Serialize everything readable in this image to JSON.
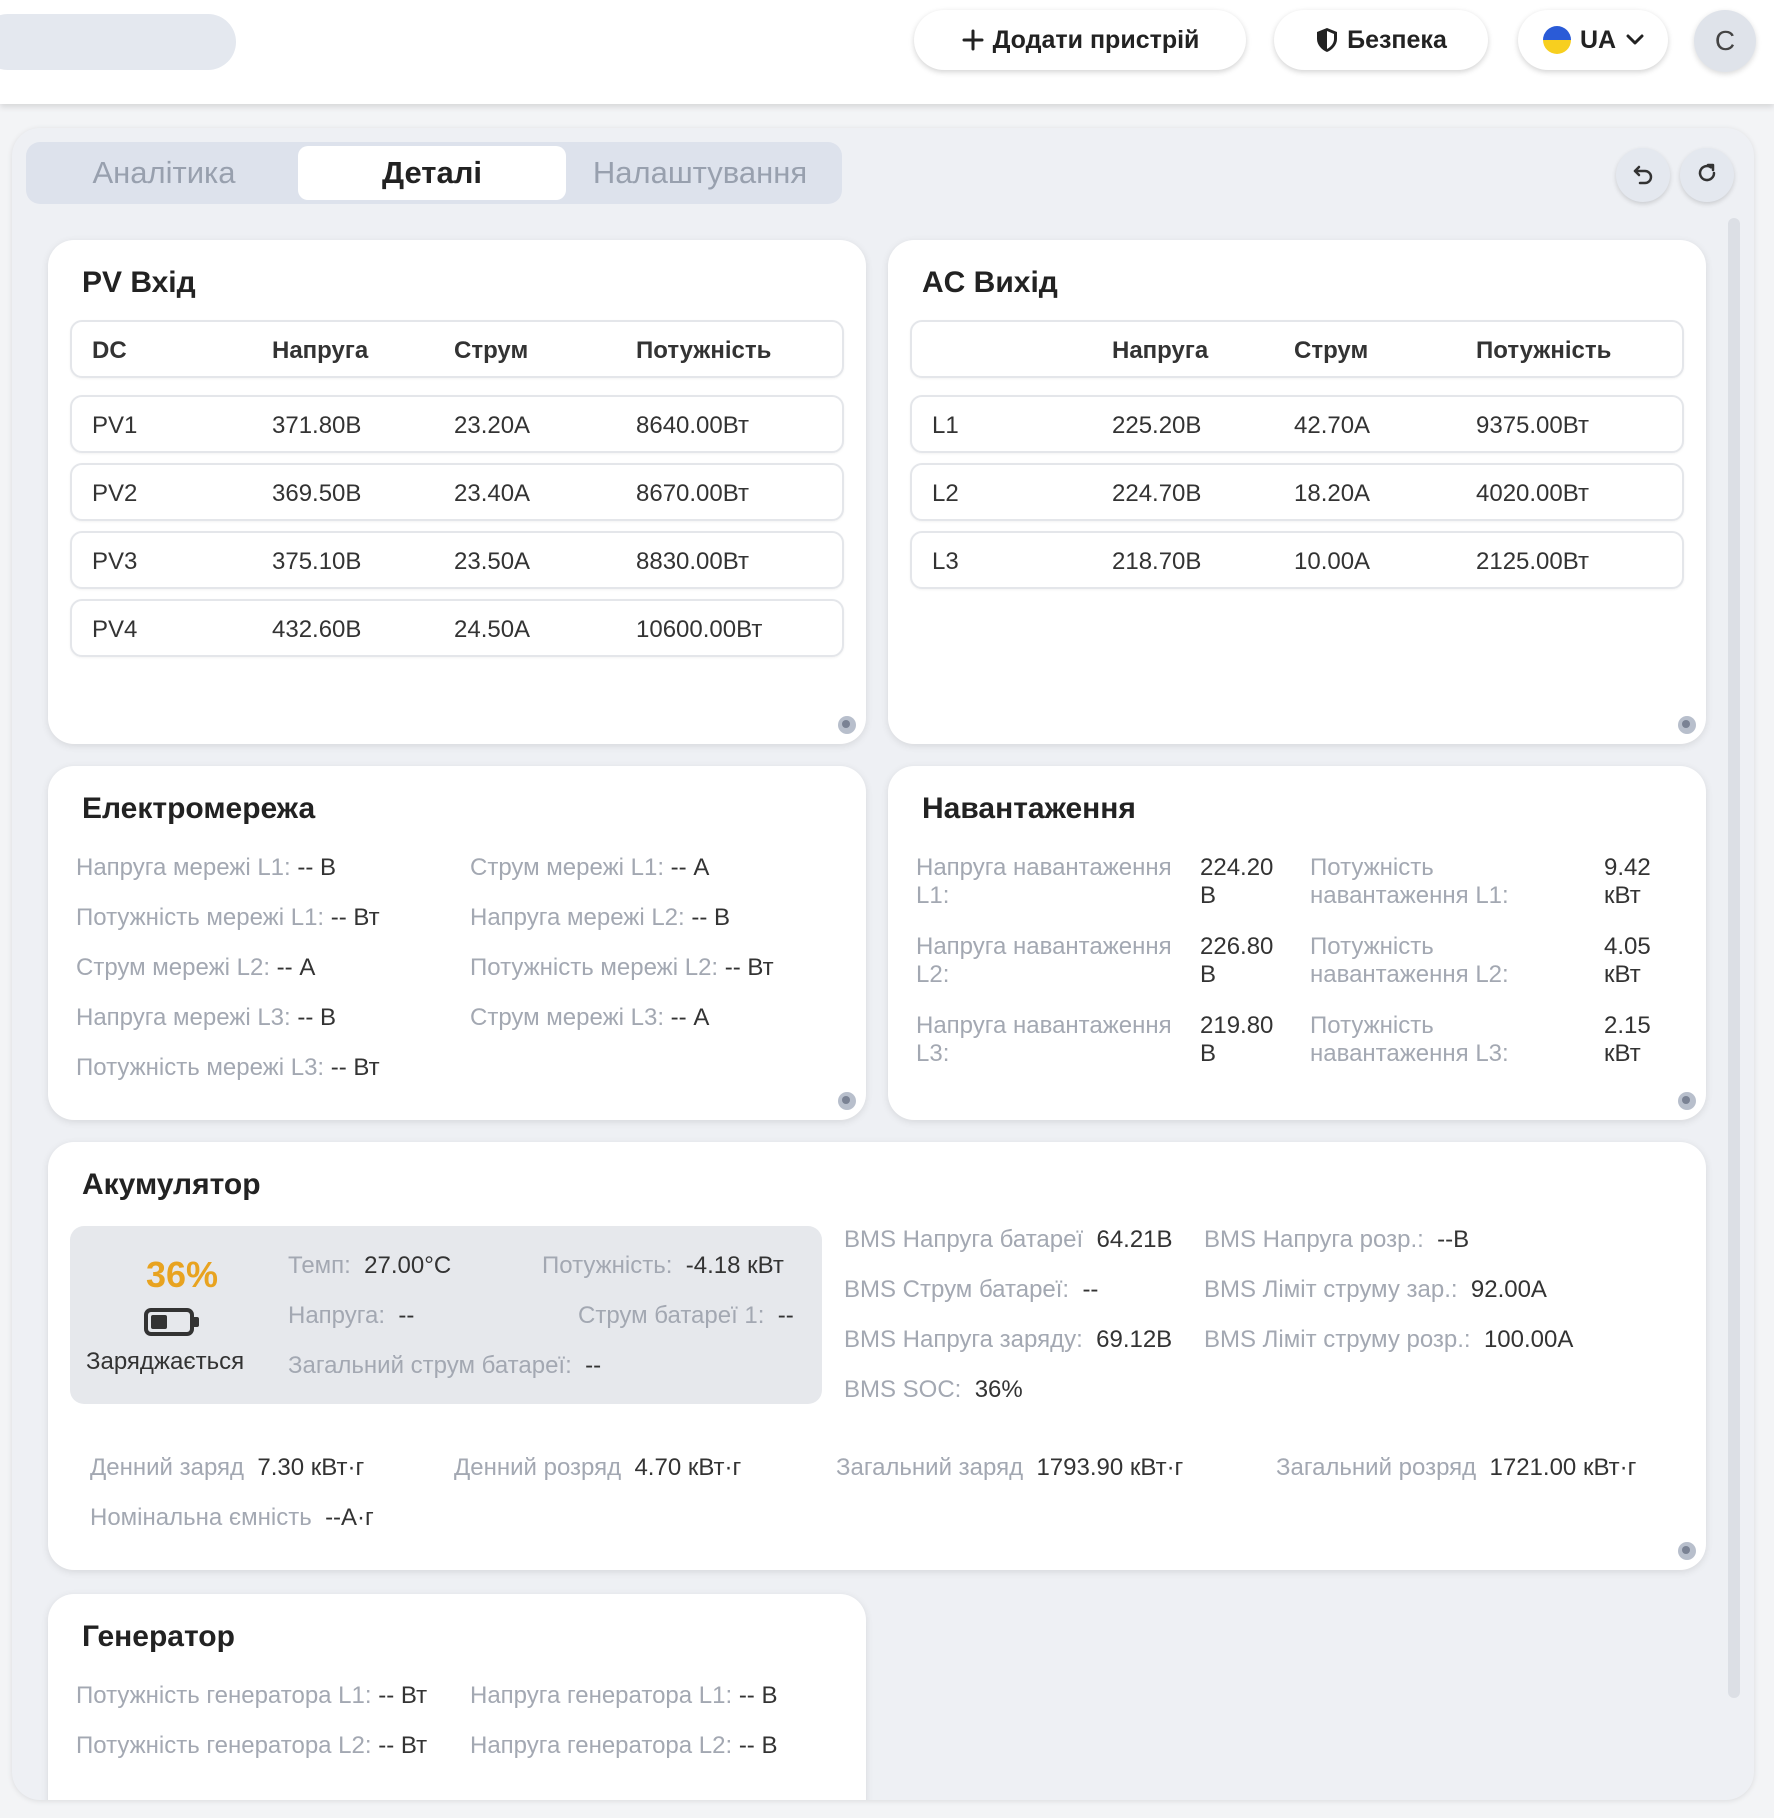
{
  "header": {
    "add_device": "Додати пристрій",
    "security": "Безпека",
    "language": "UA",
    "avatar_letter": "C"
  },
  "tabs": [
    {
      "label": "Аналітика",
      "active": false
    },
    {
      "label": "Деталі",
      "active": true
    },
    {
      "label": "Налаштування",
      "active": false
    }
  ],
  "pv": {
    "title": "PV Вхід",
    "headers": [
      "DC",
      "Напруга",
      "Струм",
      "Потужність"
    ],
    "rows": [
      [
        "PV1",
        "371.80В",
        "23.20А",
        "8640.00Вт"
      ],
      [
        "PV2",
        "369.50В",
        "23.40А",
        "8670.00Вт"
      ],
      [
        "PV3",
        "375.10В",
        "23.50А",
        "8830.00Вт"
      ],
      [
        "PV4",
        "432.60В",
        "24.50А",
        "10600.00Вт"
      ]
    ]
  },
  "ac": {
    "title": "AC Вихід",
    "headers": [
      "",
      "Напруга",
      "Струм",
      "Потужність"
    ],
    "rows": [
      [
        "L1",
        "225.20В",
        "42.70А",
        "9375.00Вт"
      ],
      [
        "L2",
        "224.70В",
        "18.20А",
        "4020.00Вт"
      ],
      [
        "L3",
        "218.70В",
        "10.00А",
        "2125.00Вт"
      ]
    ]
  },
  "grid": {
    "title": "Електромережа",
    "items": [
      {
        "label": "Напруга мережі L1:",
        "value": "-- В"
      },
      {
        "label": "Струм мережі L1:",
        "value": "-- А"
      },
      {
        "label": "Потужність мережі L1:",
        "value": "-- Вт"
      },
      {
        "label": "Напруга мережі L2:",
        "value": "-- В"
      },
      {
        "label": "Струм мережі L2:",
        "value": "-- А"
      },
      {
        "label": "Потужність мережі L2:",
        "value": "-- Вт"
      },
      {
        "label": "Напруга мережі L3:",
        "value": "-- В"
      },
      {
        "label": "Струм мережі L3:",
        "value": "-- А"
      },
      {
        "label": "Потужність мережі L3:",
        "value": "-- Вт"
      }
    ]
  },
  "load": {
    "title": "Навантаження",
    "items": [
      {
        "label1": "Напруга навантаження",
        "label2": "L1:",
        "v1": "224.20",
        "v2": "В",
        "plabel1": "Потужність",
        "plabel2": "навантаження L1:",
        "pv1": "9.42",
        "pv2": "кВт"
      },
      {
        "label1": "Напруга навантаження",
        "label2": "L2:",
        "v1": "226.80",
        "v2": "В",
        "plabel1": "Потужність",
        "plabel2": "навантаження L2:",
        "pv1": "4.05",
        "pv2": "кВт"
      },
      {
        "label1": "Напруга навантаження",
        "label2": "L3:",
        "v1": "219.80",
        "v2": "В",
        "plabel1": "Потужність",
        "plabel2": "навантаження L3:",
        "pv1": "2.15",
        "pv2": "кВт"
      }
    ]
  },
  "battery": {
    "title": "Акумулятор",
    "percent": "36%",
    "level": 0.36,
    "status": "Заряджається",
    "temp_label": "Темп:",
    "temp_value": "27.00°C",
    "power_label": "Потужність:",
    "power_value": "-4.18 кВт",
    "voltage_label": "Напруга:",
    "voltage_value": "--",
    "current1_label": "Струм батареї 1:",
    "current1_value": "--",
    "total_current_label": "Загальний струм батареї:",
    "total_current_value": "--",
    "bms": [
      {
        "label": "BMS Напруга батареї",
        "value": "64.21В"
      },
      {
        "label": "BMS Напруга розр.:",
        "value": "--В"
      },
      {
        "label": "BMS Струм батареї:",
        "value": "--"
      },
      {
        "label": "BMS Ліміт струму зар.:",
        "value": "92.00А"
      },
      {
        "label": "BMS Напруга заряду:",
        "value": "69.12В"
      },
      {
        "label": "BMS Ліміт струму розр.:",
        "value": "100.00А"
      },
      {
        "label": "BMS SOC:",
        "value": "36%"
      }
    ],
    "stats": [
      {
        "label": "Денний заряд",
        "value": "7.30 кВт·г"
      },
      {
        "label": "Денний розряд",
        "value": "4.70 кВт·г"
      },
      {
        "label": "Загальний заряд",
        "value": "1793.90 кВт·г"
      },
      {
        "label": "Загальний розряд",
        "value": "1721.00 кВт·г"
      },
      {
        "label": "Номінальна ємність",
        "value": "--А·г"
      }
    ]
  },
  "generator": {
    "title": "Генератор",
    "items": [
      {
        "label": "Потужність генератора L1:",
        "value": "-- Вт"
      },
      {
        "label": "Напруга генератора L1:",
        "value": "-- В"
      },
      {
        "label": "Потужність генератора L2:",
        "value": "-- Вт"
      },
      {
        "label": "Напруга генератора L2:",
        "value": "-- В"
      }
    ]
  },
  "colors": {
    "accent_orange": "#e8a320",
    "label_gray": "#a3a8b2",
    "tab_bg": "#dde2ec"
  },
  "icons": [
    "plus-icon",
    "shield-icon",
    "ukraine-flag-icon",
    "chevron-down-icon",
    "undo-icon",
    "refresh-icon",
    "battery-icon",
    "resize-handle-icon"
  ]
}
